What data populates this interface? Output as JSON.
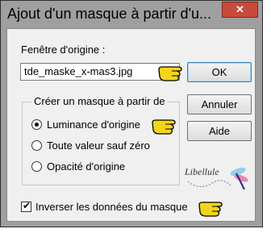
{
  "window": {
    "title": "Ajout d'un masque à partir d'u...",
    "close_glyph": "✕"
  },
  "source": {
    "label": "Fenêtre d'origine :",
    "value": "tde_maske_x-mas3.jpg"
  },
  "buttons": {
    "ok": "OK",
    "cancel": "Annuler",
    "help": "Aide"
  },
  "group": {
    "title": "Créer un masque à partir de",
    "options": [
      {
        "label": "Luminance d'origine",
        "checked": true
      },
      {
        "label": "Toute valeur sauf zéro",
        "checked": false
      },
      {
        "label": "Opacité d'origine",
        "checked": false
      }
    ]
  },
  "invert": {
    "label": "Inverser les données du masque",
    "checked": true
  },
  "watermark": {
    "text": "Libellule"
  },
  "colors": {
    "titlebar": "#9f9f9f",
    "close": "#c74a3a",
    "hand": "#f2d51a",
    "ok_border": "#3c7fb1"
  },
  "icons": [
    "close-icon",
    "pointing-hand-icon",
    "dragonfly-icon"
  ]
}
